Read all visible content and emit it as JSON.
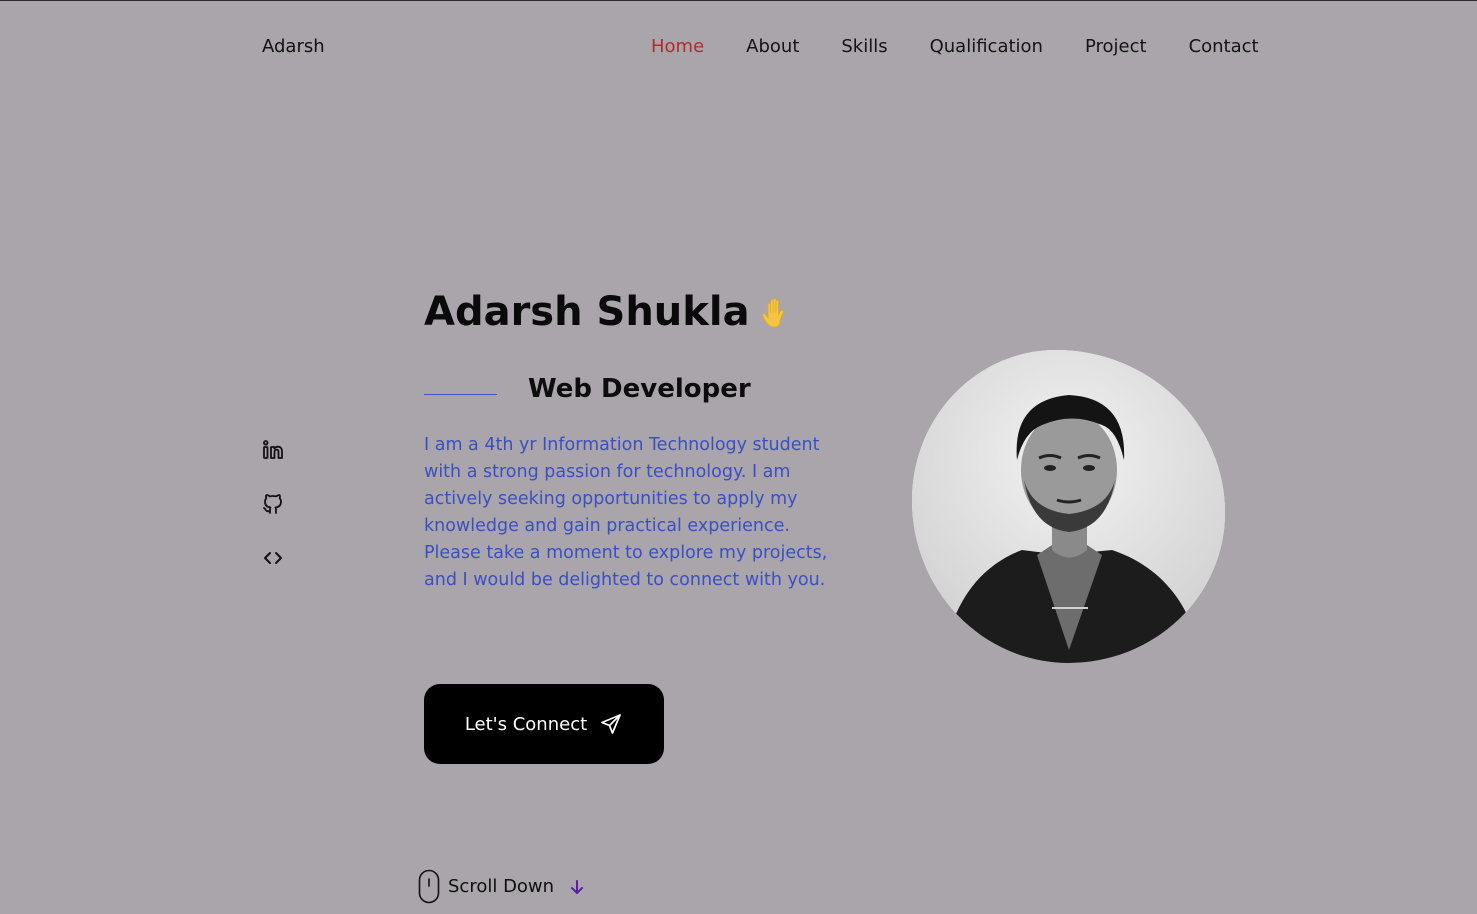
{
  "header": {
    "logo": "Adarsh",
    "nav": [
      "Home",
      "About",
      "Skills",
      "Qualification",
      "Project",
      "Contact"
    ],
    "active_nav": "Home"
  },
  "socials": [
    {
      "icon": "linkedin-icon"
    },
    {
      "icon": "github-icon"
    },
    {
      "icon": "code-icon"
    }
  ],
  "hero": {
    "name": "Adarsh Shukla",
    "wave_icon": "waving-hand-icon",
    "subtitle": "Web Developer",
    "description": "I am a 4th yr Information Technology student with a strong passion for technology. I am actively seeking opportunities to apply my knowledge and gain practical experience. Please take a moment to explore my projects, and I would be delighted to connect with you.",
    "cta_label": "Let's Connect"
  },
  "scroll": {
    "label": "Scroll Down"
  },
  "colors": {
    "background": "#a9a5aa",
    "active_nav": "#b22a31",
    "accent_blue": "#3b4fc4",
    "button_bg": "#000000",
    "scroll_arrow": "#5b1fa6"
  }
}
